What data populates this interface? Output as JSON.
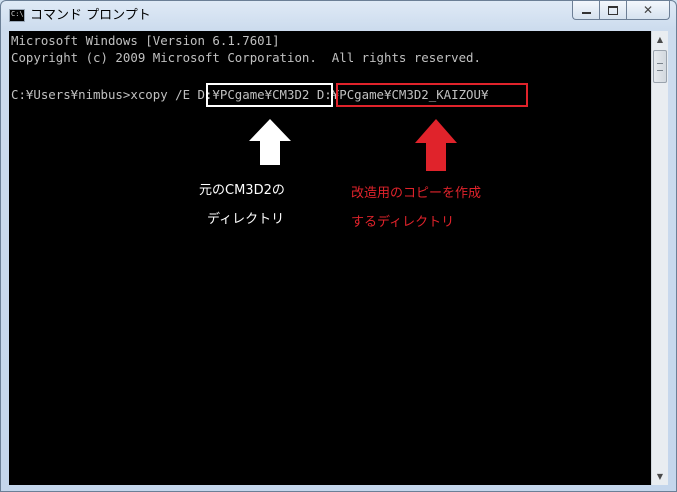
{
  "window": {
    "title": "コマンド プロンプト",
    "icon_text": "C:\\"
  },
  "console": {
    "lines": [
      "Microsoft Windows [Version 6.1.7601]",
      "Copyright (c) 2009 Microsoft Corporation.  All rights reserved.",
      "",
      "C:¥Users¥nimbus>xcopy /E D:¥PCgame¥CM3D2 D:¥PCgame¥CM3D2_KAIZOU¥"
    ]
  },
  "annotations": {
    "source": {
      "highlighted_text": "D:¥PCgame¥CM3D2",
      "label_line1": "元のCM3D2の",
      "label_line2": "ディレクトリ",
      "color": "#ffffff"
    },
    "destination": {
      "highlighted_text": "D:¥PCgame¥CM3D2_KAIZOU¥",
      "label_line1": "改造用のコピーを作成",
      "label_line2": "するディレクトリ",
      "color": "#e0232b"
    }
  },
  "icons": {
    "minimize": "minimize-icon",
    "maximize": "maximize-icon",
    "close": "close-icon",
    "scroll_up": "scroll-up-arrow-icon",
    "scroll_down": "scroll-down-arrow-icon"
  }
}
